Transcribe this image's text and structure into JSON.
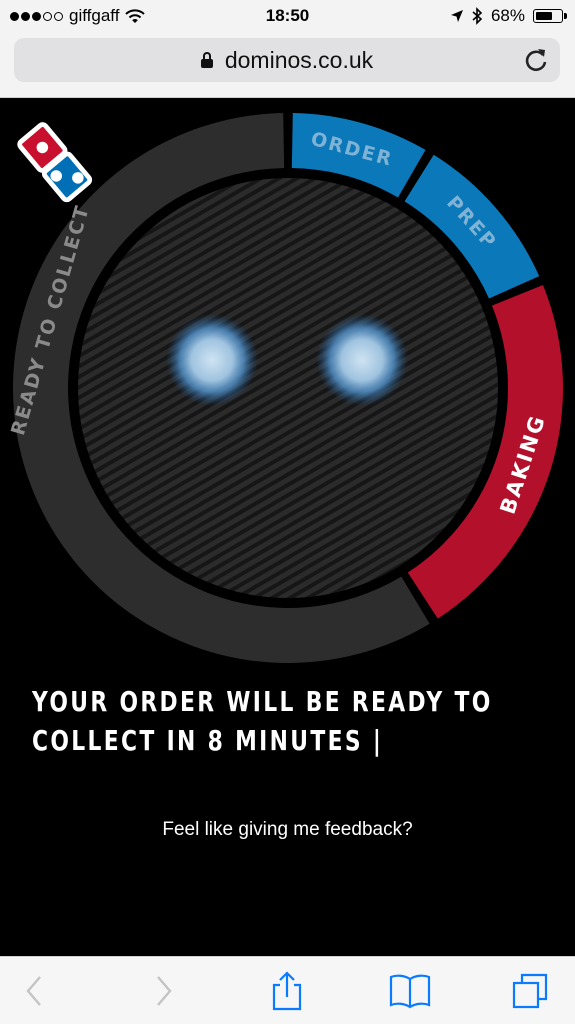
{
  "status_bar": {
    "carrier": "giffgaff",
    "time": "18:50",
    "battery": "68%",
    "battery_level": 0.68
  },
  "browser": {
    "url": "dominos.co.uk"
  },
  "tracker": {
    "stages": [
      "ORDER",
      "PREP",
      "BAKING",
      "READY TO COLLECT"
    ],
    "colors": {
      "blue": "#0b78b9",
      "red": "#b3102c",
      "grey": "#2d2d2d"
    }
  },
  "message": {
    "line1": "YOUR ORDER WILL BE READY TO",
    "line2": "COLLECT IN 8 MINUTES |"
  },
  "feedback": "Feel like giving me feedback?",
  "toolbar": {
    "icons": [
      "back-icon",
      "forward-icon",
      "share-icon",
      "bookmarks-icon",
      "tabs-icon"
    ]
  }
}
